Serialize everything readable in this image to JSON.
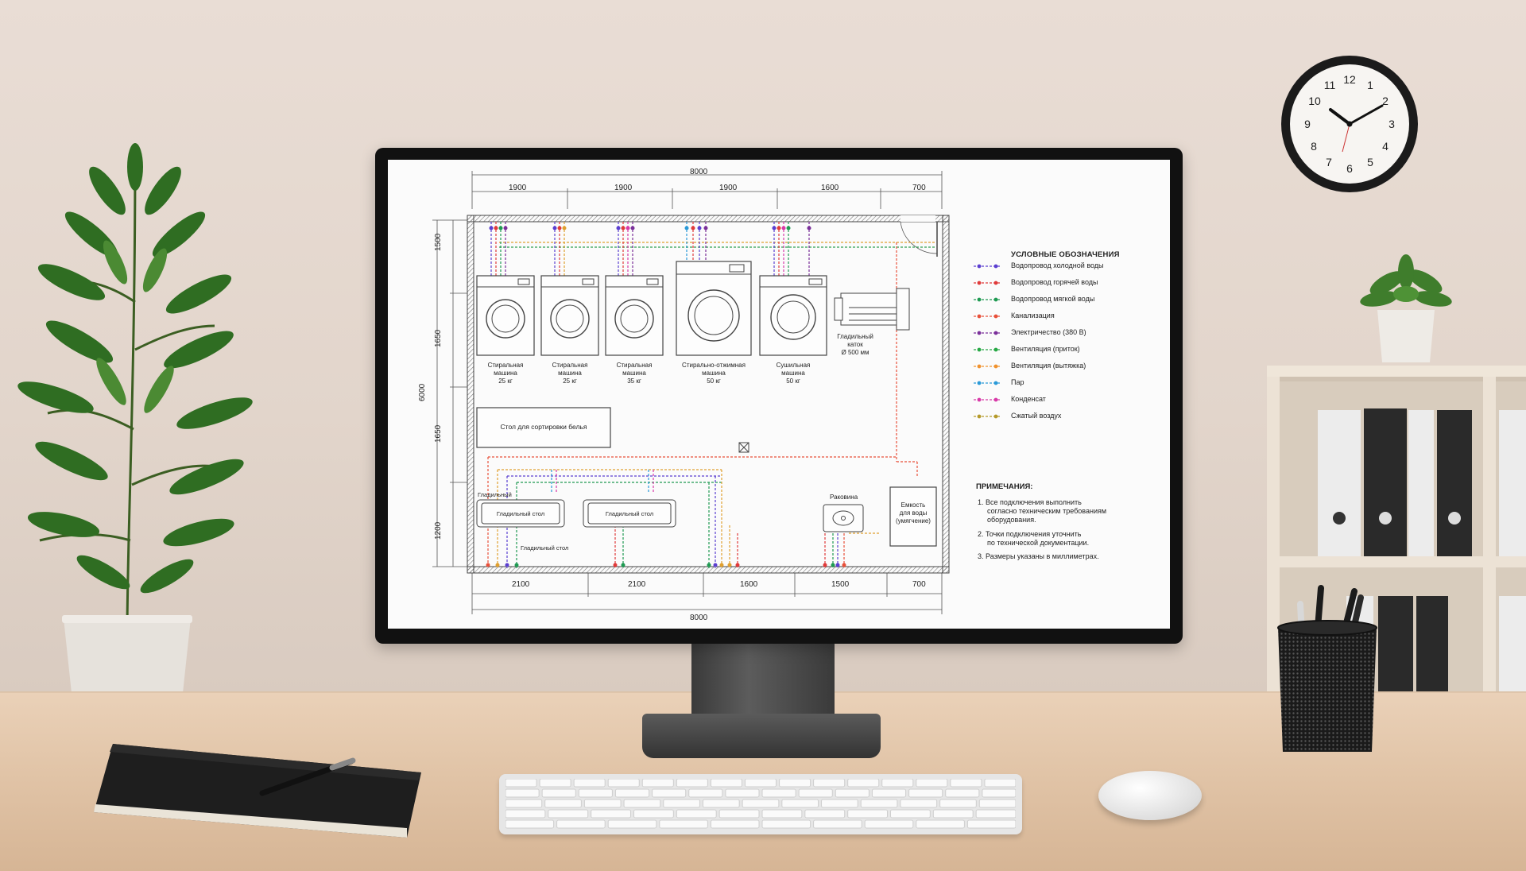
{
  "drawing": {
    "top_dims": [
      "1900",
      "1900",
      "1900",
      "1600",
      "700"
    ],
    "top_total": "8000",
    "bottom_dims": [
      "2100",
      "2100",
      "1600",
      "1500",
      "700"
    ],
    "bottom_total": "8000",
    "left_dims": [
      "1500",
      "1650",
      "1650",
      "1200"
    ],
    "left_total": "6000",
    "equipment": [
      {
        "lines": [
          "Стиральная",
          "машина",
          "25 кг"
        ]
      },
      {
        "lines": [
          "Стиральная",
          "машина",
          "25 кг"
        ]
      },
      {
        "lines": [
          "Стиральная",
          "машина",
          "35 кг"
        ]
      },
      {
        "lines": [
          "Стирально-отжимная",
          "машина",
          "50 кг"
        ]
      },
      {
        "lines": [
          "Сушильная",
          "машина",
          "50 кг"
        ]
      },
      {
        "lines": [
          "Гладильный",
          "каток",
          "Ø 500 мм"
        ]
      }
    ],
    "sorting_table": "Стол для сортировки белья",
    "ironing_table_1": "Гладильный стол",
    "ironing_table_2": "Гладильный стол",
    "ironing_label_top": "Гладильный",
    "ironing_label_bottom": "Гладильный стол",
    "sink": "Раковина",
    "tank": [
      "Емкость",
      "для воды",
      "(умягчение)"
    ]
  },
  "legend": {
    "title": "УСЛОВНЫЕ ОБОЗНАЧЕНИЯ",
    "items": [
      {
        "label": "Водопровод холодной воды",
        "color": "#5b3fd0"
      },
      {
        "label": "Водопровод горячей воды",
        "color": "#e03a3a"
      },
      {
        "label": "Водопровод мягкой воды",
        "color": "#1f9a52"
      },
      {
        "label": "Канализация",
        "color": "#e8503a"
      },
      {
        "label": "Электричество (380 В)",
        "color": "#7a2f9a"
      },
      {
        "label": "Вентиляция (приток)",
        "color": "#27a845"
      },
      {
        "label": "Вентиляция (вытяжка)",
        "color": "#f0922e"
      },
      {
        "label": "Пар",
        "color": "#2a9ad8"
      },
      {
        "label": "Конденсат",
        "color": "#d83aa8"
      },
      {
        "label": "Сжатый воздух",
        "color": "#b59a2a"
      }
    ]
  },
  "notes": {
    "title": "ПРИМЕЧАНИЯ:",
    "items": [
      [
        "1. Все подключения выполнить",
        "    согласно техническим требованиям",
        "    оборудования."
      ],
      [
        "2. Точки подключения уточнить",
        "    по технической документации."
      ],
      [
        "3. Размеры указаны в миллиметрах."
      ]
    ]
  },
  "clock": {
    "numbers": [
      "12",
      "1",
      "2",
      "3",
      "4",
      "5",
      "6",
      "7",
      "8",
      "9",
      "10",
      "11"
    ]
  }
}
